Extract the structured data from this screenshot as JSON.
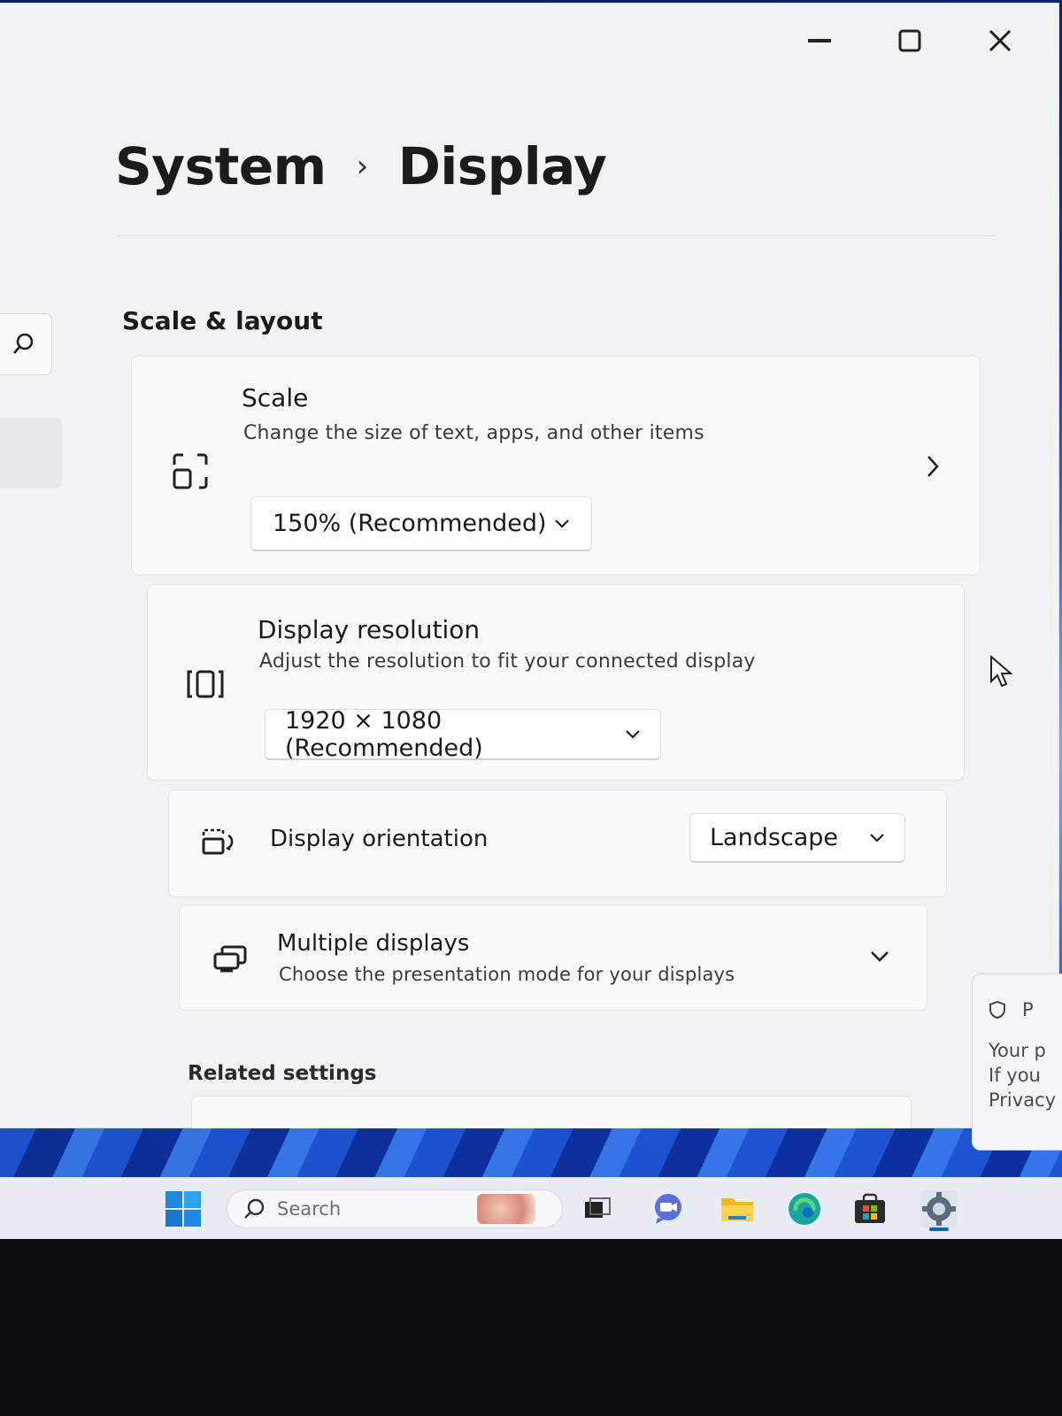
{
  "window": {
    "controls": {
      "minimize": "minimize",
      "maximize": "maximize",
      "close": "close"
    }
  },
  "breadcrumb": {
    "parent": "System",
    "separator": "›",
    "current": "Display"
  },
  "section": {
    "title": "Scale & layout"
  },
  "cards": {
    "scale": {
      "title": "Scale",
      "description": "Change the size of text, apps, and other items",
      "value": "150% (Recommended)",
      "icon": "scale-icon"
    },
    "resolution": {
      "title": "Display resolution",
      "description": "Adjust the resolution to fit your connected display",
      "value": "1920 × 1080 (Recommended)",
      "icon": "resolution-icon"
    },
    "orientation": {
      "title": "Display orientation",
      "value": "Landscape",
      "icon": "orientation-icon"
    },
    "multiple": {
      "title": "Multiple displays",
      "description": "Choose the presentation mode for your displays",
      "icon": "multiple-displays-icon"
    }
  },
  "related": {
    "title": "Related settings"
  },
  "taskbar": {
    "search_placeholder": "Search",
    "apps": [
      "start",
      "task-view",
      "teams-chat",
      "file-explorer",
      "edge",
      "store",
      "settings"
    ]
  },
  "notification": {
    "header_fragment": "P",
    "lines": [
      "Your p",
      "If you",
      "Privacy"
    ]
  },
  "colors": {
    "accent": "#0067c0",
    "window_bg": "#f1f2f4",
    "card_bg": "#fafafb",
    "wallpaper": "#1a4fd0"
  }
}
